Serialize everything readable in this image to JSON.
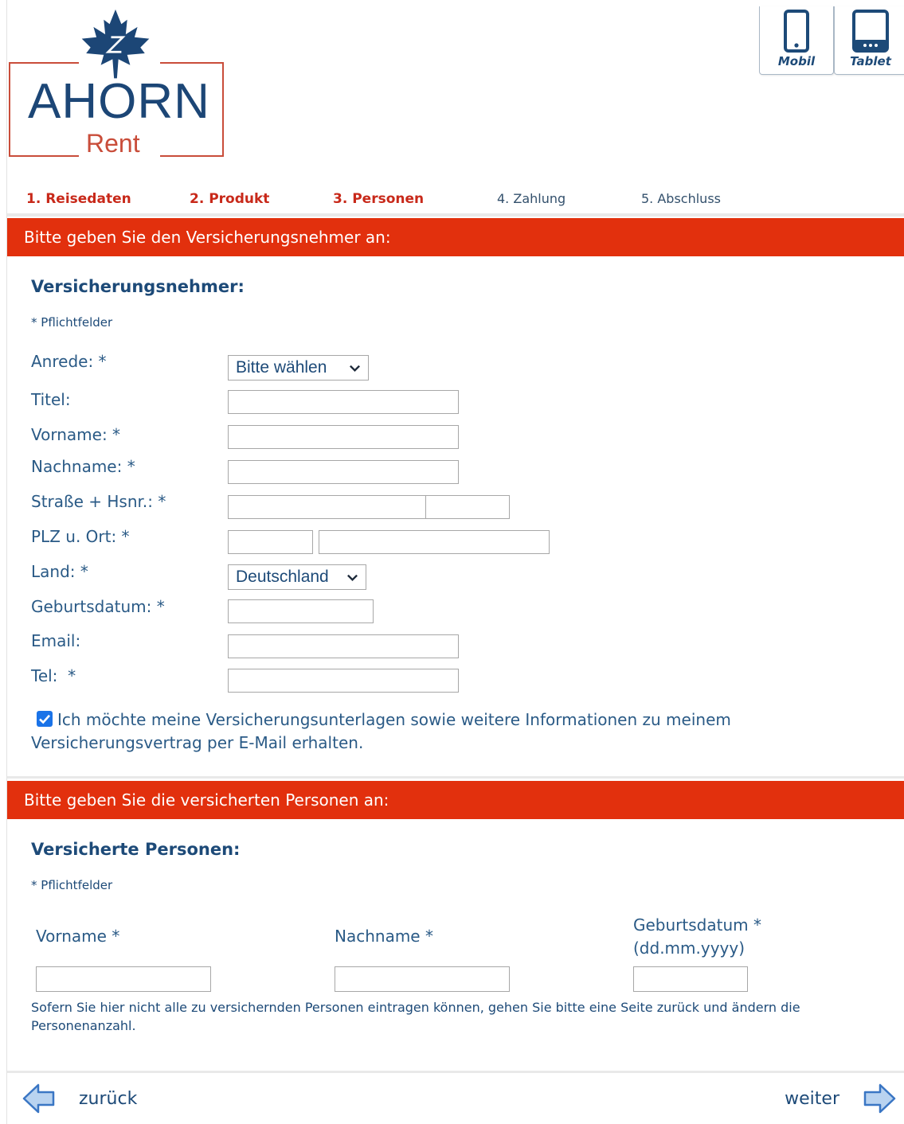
{
  "brand": {
    "name": "AHORN",
    "sub": "Rent"
  },
  "device_switch": [
    {
      "label": "Mobil",
      "icon": "phone-icon"
    },
    {
      "label": "Tablet",
      "icon": "tablet-icon"
    }
  ],
  "steps": [
    {
      "label": "1. Reisedaten",
      "state": "done"
    },
    {
      "label": "2. Produkt",
      "state": "done"
    },
    {
      "label": "3. Personen",
      "state": "current"
    },
    {
      "label": "4. Zahlung",
      "state": "todo"
    },
    {
      "label": "5. Abschluss",
      "state": "todo"
    }
  ],
  "policyholder": {
    "bar": "Bitte geben Sie den Versicherungsnehmer an:",
    "title": "Versicherungsnehmer:",
    "mandatory": "* Pflichtfelder",
    "fields": {
      "anrede": {
        "label": "Anrede: *",
        "value": "Bitte wählen"
      },
      "titel": {
        "label": "Titel:",
        "value": ""
      },
      "vorname": {
        "label": "Vorname: *",
        "value": ""
      },
      "nachname": {
        "label": "Nachname: *",
        "value": ""
      },
      "strasse": {
        "label": "Straße + Hsnr.: *",
        "value": "",
        "hsnr": ""
      },
      "plz_ort": {
        "label": "PLZ u. Ort: *",
        "plz": "",
        "ort": ""
      },
      "land": {
        "label": "Land: *",
        "value": "Deutschland"
      },
      "geburtsdatum": {
        "label": "Geburtsdatum: *",
        "value": ""
      },
      "email": {
        "label": "Email:",
        "value": ""
      },
      "tel": {
        "label": "Tel:  *",
        "value": ""
      }
    },
    "consent": {
      "checked": true,
      "text": "Ich möchte meine Versicherungsunterlagen sowie weitere Informationen zu meinem Versicherungsvertrag per E-Mail erhalten."
    }
  },
  "insured": {
    "bar": "Bitte geben Sie die versicherten Personen an:",
    "title": "Versicherte Personen:",
    "mandatory": "* Pflichtfelder",
    "columns": {
      "vorname": "Vorname *",
      "nachname": "Nachname *",
      "geburtsdatum_1": "Geburtsdatum *",
      "geburtsdatum_2": "(dd.mm.yyyy)"
    },
    "row": {
      "vorname": "",
      "nachname": "",
      "geburtsdatum": ""
    },
    "note": "Sofern Sie hier nicht alle zu versichernden Personen eintragen können, gehen Sie bitte eine Seite zurück und ändern die Personenanzahl."
  },
  "nav": {
    "back": "zurück",
    "next": "weiter"
  },
  "colors": {
    "accent": "#e2300d",
    "brand_blue": "#1c4676",
    "brand_red": "#c94d3a"
  }
}
